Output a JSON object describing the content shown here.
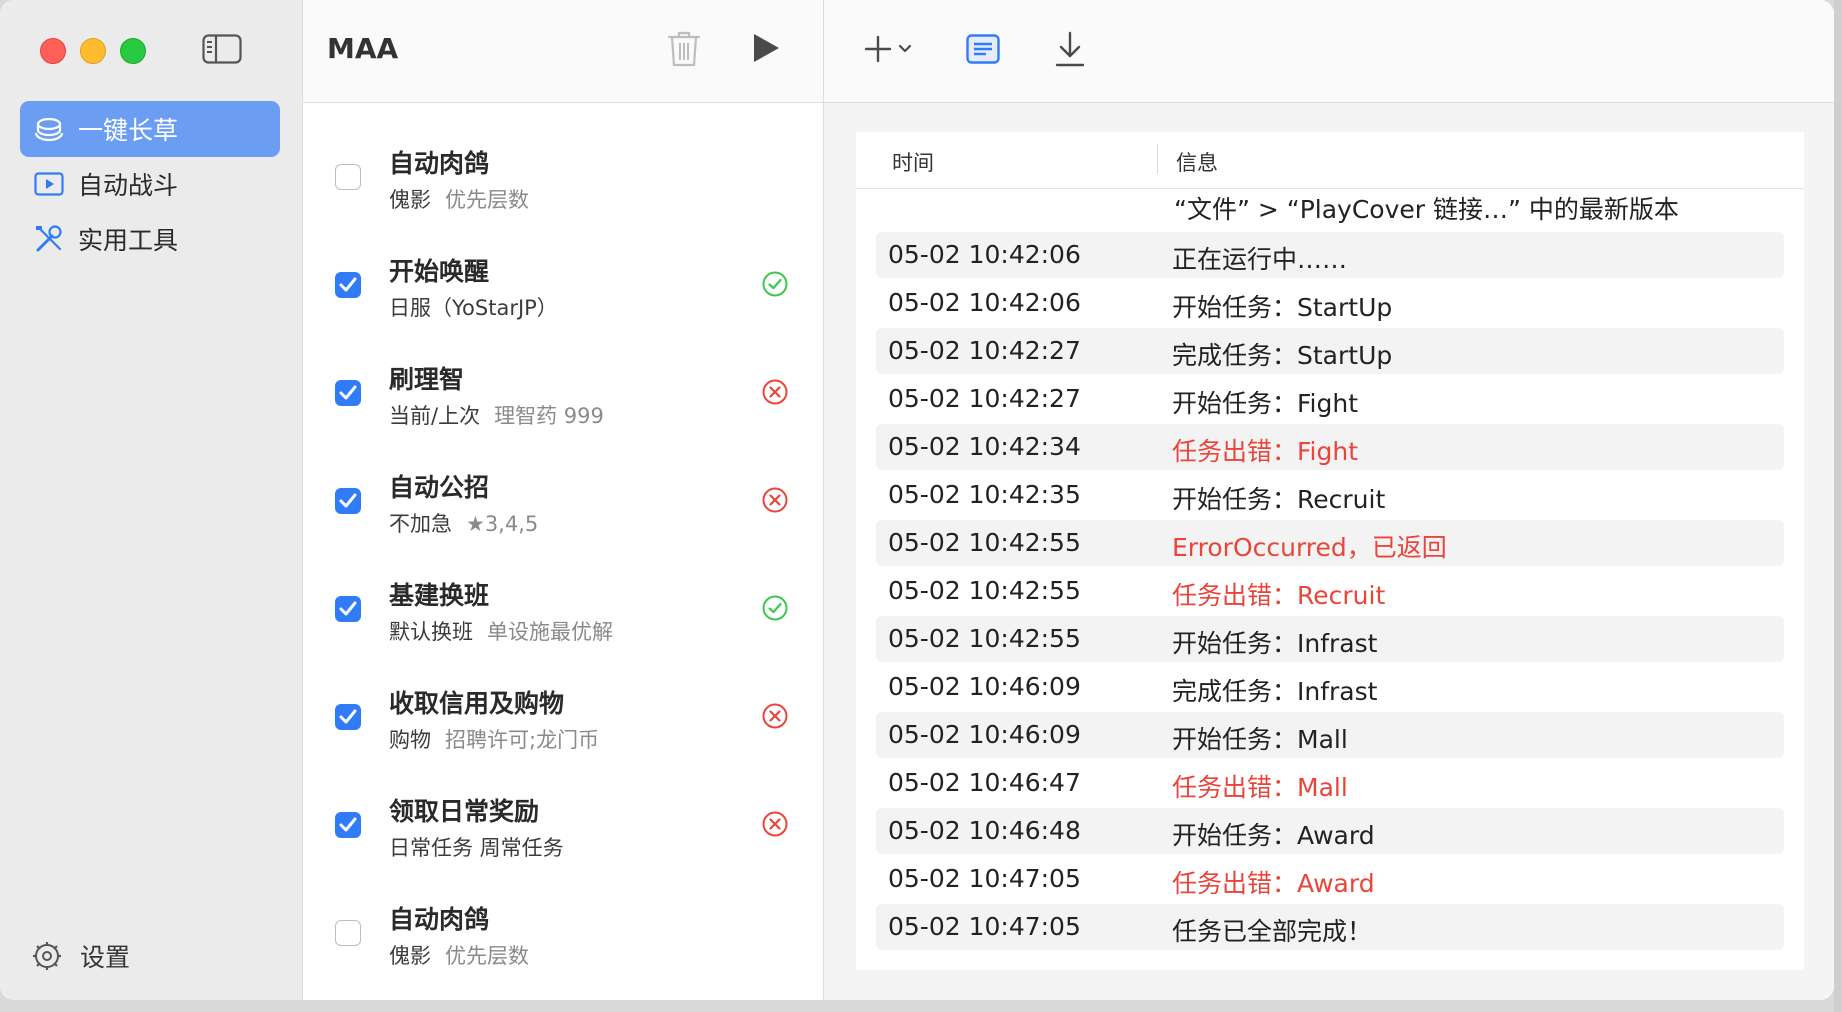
{
  "sidebar": {
    "items": [
      {
        "label": "一键长草",
        "icon": "stack-icon",
        "selected": true
      },
      {
        "label": "自动战斗",
        "icon": "play-rectangle-icon",
        "selected": false
      },
      {
        "label": "实用工具",
        "icon": "tools-icon",
        "selected": false
      }
    ],
    "settings_label": "设置"
  },
  "tasks_panel": {
    "title": "MAA",
    "tasks": [
      {
        "title": "自动肉鸽",
        "sub": "傀影",
        "sub2": "优先层数",
        "checked": false,
        "status": "none"
      },
      {
        "title": "开始唤醒",
        "sub": "日服（YoStarJP）",
        "sub2": "",
        "checked": true,
        "status": "success"
      },
      {
        "title": "刷理智",
        "sub": "当前/上次",
        "sub2": "理智药 999",
        "checked": true,
        "status": "error"
      },
      {
        "title": "自动公招",
        "sub": "不加急",
        "sub2": "★3,4,5",
        "checked": true,
        "status": "error"
      },
      {
        "title": "基建换班",
        "sub": "默认换班",
        "sub2": "单设施最优解",
        "checked": true,
        "status": "success"
      },
      {
        "title": "收取信用及购物",
        "sub": "购物",
        "sub2": "招聘许可;龙门币",
        "checked": true,
        "status": "error"
      },
      {
        "title": "领取日常奖励",
        "sub": "日常任务 周常任务",
        "sub2": "",
        "checked": true,
        "status": "error"
      },
      {
        "title": "自动肉鸽",
        "sub": "傀影",
        "sub2": "优先层数",
        "checked": false,
        "status": "none"
      }
    ]
  },
  "log": {
    "col_time": "时间",
    "col_info": "信息",
    "partial_line": "“文件” > “PlayCover 链接…” 中的最新版本",
    "rows": [
      {
        "time": "05-02 10:42:06",
        "msg": "正在运行中……",
        "error": false
      },
      {
        "time": "05-02 10:42:06",
        "msg": "开始任务：StartUp",
        "error": false
      },
      {
        "time": "05-02 10:42:27",
        "msg": "完成任务：StartUp",
        "error": false
      },
      {
        "time": "05-02 10:42:27",
        "msg": "开始任务：Fight",
        "error": false
      },
      {
        "time": "05-02 10:42:34",
        "msg": "任务出错：Fight",
        "error": true
      },
      {
        "time": "05-02 10:42:35",
        "msg": "开始任务：Recruit",
        "error": false
      },
      {
        "time": "05-02 10:42:55",
        "msg": "ErrorOccurred，已返回",
        "error": true
      },
      {
        "time": "05-02 10:42:55",
        "msg": "任务出错：Recruit",
        "error": true
      },
      {
        "time": "05-02 10:42:55",
        "msg": "开始任务：Infrast",
        "error": false
      },
      {
        "time": "05-02 10:46:09",
        "msg": "完成任务：Infrast",
        "error": false
      },
      {
        "time": "05-02 10:46:09",
        "msg": "开始任务：Mall",
        "error": false
      },
      {
        "time": "05-02 10:46:47",
        "msg": "任务出错：Mall",
        "error": true
      },
      {
        "time": "05-02 10:46:48",
        "msg": "开始任务：Award",
        "error": false
      },
      {
        "time": "05-02 10:47:05",
        "msg": "任务出错：Award",
        "error": true
      },
      {
        "time": "05-02 10:47:05",
        "msg": "任务已全部完成！",
        "error": false
      }
    ]
  },
  "colors": {
    "accent": "#2f7cf6",
    "selected_nav": "#6b9ef3",
    "success": "#3cc84b",
    "error": "#e8463a"
  }
}
